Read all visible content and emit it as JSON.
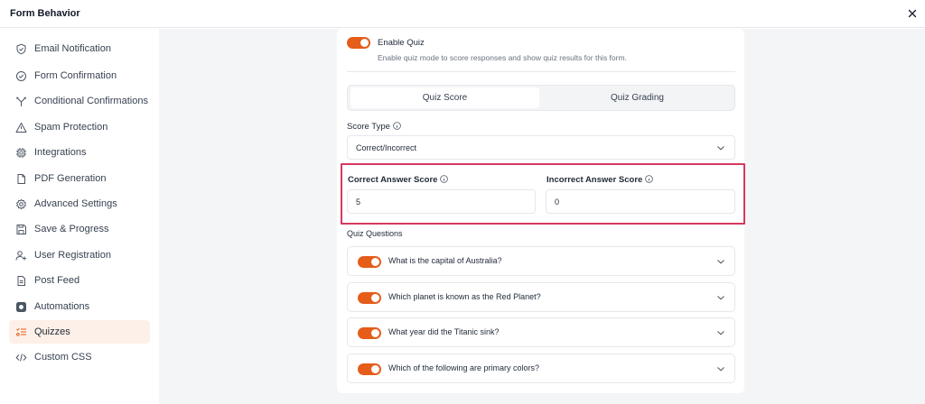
{
  "window": {
    "title": "Form Behavior"
  },
  "sidebar": {
    "items": [
      {
        "label": "Email Notification",
        "icon": "shield-check-icon",
        "active": false
      },
      {
        "label": "Form Confirmation",
        "icon": "check-circle-icon",
        "active": false
      },
      {
        "label": "Conditional Confirmations",
        "icon": "branch-icon",
        "active": false
      },
      {
        "label": "Spam Protection",
        "icon": "warning-triangle-icon",
        "active": false
      },
      {
        "label": "Integrations",
        "icon": "chip-icon",
        "active": false
      },
      {
        "label": "PDF Generation",
        "icon": "file-icon",
        "active": false
      },
      {
        "label": "Advanced Settings",
        "icon": "gear-icon",
        "active": false
      },
      {
        "label": "Save & Progress",
        "icon": "save-icon",
        "active": false
      },
      {
        "label": "User Registration",
        "icon": "user-plus-icon",
        "active": false
      },
      {
        "label": "Post Feed",
        "icon": "document-icon",
        "active": false
      },
      {
        "label": "Automations",
        "icon": "automation-icon",
        "active": false
      },
      {
        "label": "Quizzes",
        "icon": "quiz-list-icon",
        "active": true
      },
      {
        "label": "Custom CSS",
        "icon": "code-icon",
        "active": false
      }
    ]
  },
  "quiz": {
    "enable_label": "Enable Quiz",
    "enable_desc": "Enable quiz mode to score responses and show quiz results for this form.",
    "enabled": true,
    "tabs": [
      {
        "label": "Quiz Score",
        "active": true
      },
      {
        "label": "Quiz Grading",
        "active": false
      }
    ],
    "score_type": {
      "label": "Score Type",
      "value": "Correct/Incorrect"
    },
    "correct_score": {
      "label": "Correct Answer Score",
      "value": "5"
    },
    "incorrect_score": {
      "label": "Incorrect Answer Score",
      "value": "0"
    },
    "questions_label": "Quiz Questions",
    "questions": [
      {
        "text": "What is the capital of Australia?",
        "enabled": true
      },
      {
        "text": "Which planet is known as the Red Planet?",
        "enabled": true
      },
      {
        "text": "What year did the Titanic sink?",
        "enabled": true
      },
      {
        "text": "Which of the following are primary colors?",
        "enabled": true
      }
    ]
  },
  "colors": {
    "accent": "#e65c19",
    "highlight": "#d6385f",
    "active_bg": "#fdf0e8"
  }
}
